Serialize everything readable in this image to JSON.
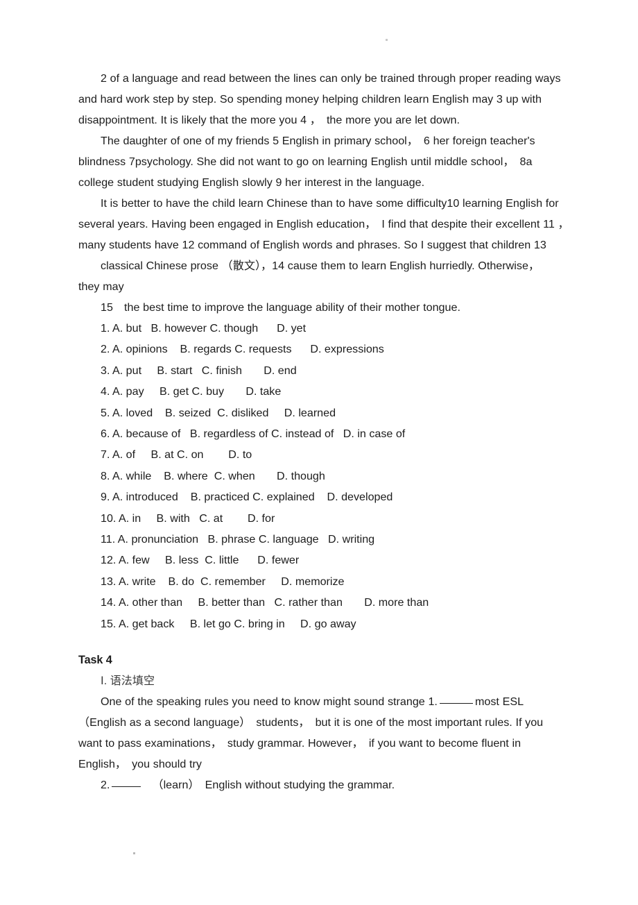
{
  "document": {
    "paragraphs": [
      {
        "id": "p1",
        "indent": true,
        "text": "2 of a language and read between the lines can only be trained through proper reading ways and hard work step by step. So spending money helping children learn English may 3 up with disappointment. It is likely that the more you 4 ，　the more you are let down."
      },
      {
        "id": "p2",
        "indent": true,
        "text": "The daughter of one of my friends 5 English in primary school，　6 her foreign teacher's blindness 7psychology. She did not want to go on learning English until middle school，　8a college student studying English slowly 9 her interest in the language."
      },
      {
        "id": "p3",
        "indent": true,
        "text": "It is better to have the child learn Chinese than to have some difficulty10 learning English for several years. Having been engaged in English education，　I find that despite their excellent 11 ，　many students have 12 command of English words and phrases. So I suggest that children 13"
      },
      {
        "id": "p4",
        "indent": true,
        "text": "classical Chinese prose （散文），14 cause them to learn English hurriedly. Otherwise，　they may"
      },
      {
        "id": "p5",
        "indent": true,
        "text": "15　the best time to improve the language ability of their mother tongue."
      }
    ],
    "options": [
      {
        "number": "1.",
        "line": "1. A. but   B. however C. though      D. yet"
      },
      {
        "number": "2.",
        "line": "2. A. opinions    B. regards C. requests      D. expressions"
      },
      {
        "number": "3.",
        "line": "3. A. put     B. start   C. finish       D. end"
      },
      {
        "number": "4.",
        "line": "4. A. pay     B. get C. buy       D. take"
      },
      {
        "number": "5.",
        "line": "5. A. loved    B. seized  C. disliked     D. learned"
      },
      {
        "number": "6.",
        "line": "6. A. because of   B. regardless of C. instead of   D. in case of"
      },
      {
        "number": "7.",
        "line": "7. A. of     B. at C. on        D. to"
      },
      {
        "number": "8.",
        "line": "8. A. while    B. where  C. when       D. though"
      },
      {
        "number": "9.",
        "line": "9. A. introduced    B. practiced C. explained    D. developed"
      },
      {
        "number": "10.",
        "line": "10. A. in     B. with   C. at        D. for"
      },
      {
        "number": "11.",
        "line": "11. A. pronunciation   B. phrase C. language   D. writing"
      },
      {
        "number": "12.",
        "line": "12. A. few     B. less  C. little      D. fewer"
      },
      {
        "number": "13.",
        "line": "13. A. write    B. do  C. remember     D. memorize"
      },
      {
        "number": "14.",
        "line": "14. A. other than     B. better than   C. rather than       D. more than"
      },
      {
        "number": "15.",
        "line": "15. A. get back     B. let go C. bring in     D. go away"
      }
    ],
    "task": {
      "heading": "Task 4",
      "section_heading": "Ⅰ. 语法填空",
      "body_part1": "One of the speaking rules you need to know might sound strange 1.",
      "body_part2": "most ESL　（English as a second language）　students，　but it is one of the most important rules. If you want to pass examinations，　study grammar. However，　if you want to become fluent in English，　you should try",
      "numbered_item": "2.",
      "numbered_rest": "（learn）　English without studying the grammar."
    }
  }
}
